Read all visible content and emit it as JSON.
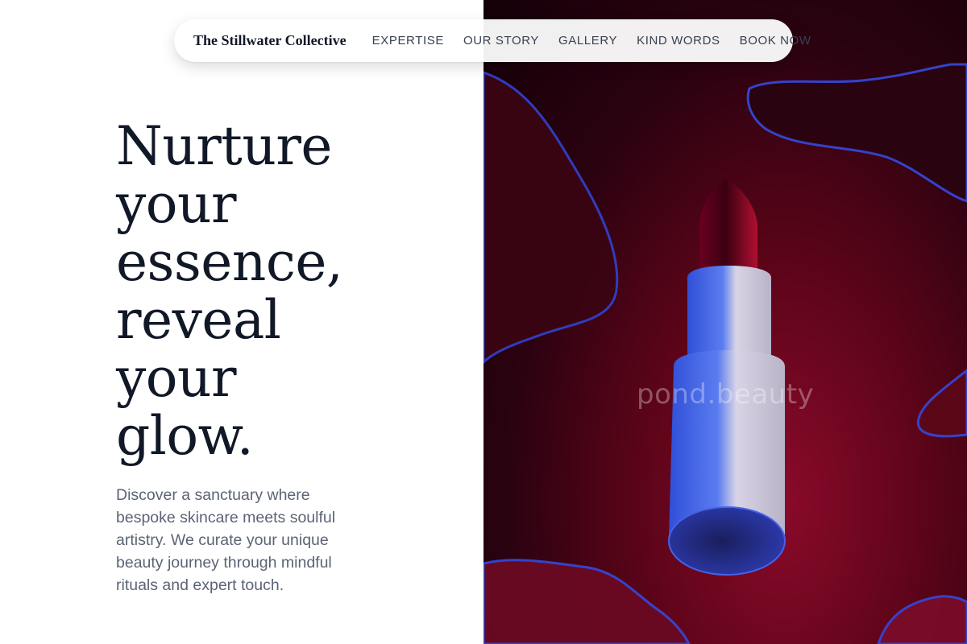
{
  "nav": {
    "brand": "The Stillwater Collective",
    "links": [
      {
        "label": "EXPERTISE"
      },
      {
        "label": "OUR STORY"
      },
      {
        "label": "GALLERY"
      },
      {
        "label": "KIND WORDS"
      },
      {
        "label": "BOOK NOW"
      }
    ]
  },
  "hero": {
    "title_lines": [
      "Nurture",
      "your",
      "essence,",
      "reveal",
      "your",
      "glow."
    ],
    "description": "Discover a sanctuary where bespoke skincare meets soulful artistry. We curate your unique beauty journey through mindful rituals and expert touch."
  },
  "image": {
    "subject": "lipstick",
    "watermark": "pond.beauty"
  },
  "colors": {
    "text_dark": "#111827",
    "text_muted": "#5b6474",
    "backdrop_red": "#5a0418",
    "lipstick_tube_blue": "#3b5bdb"
  }
}
